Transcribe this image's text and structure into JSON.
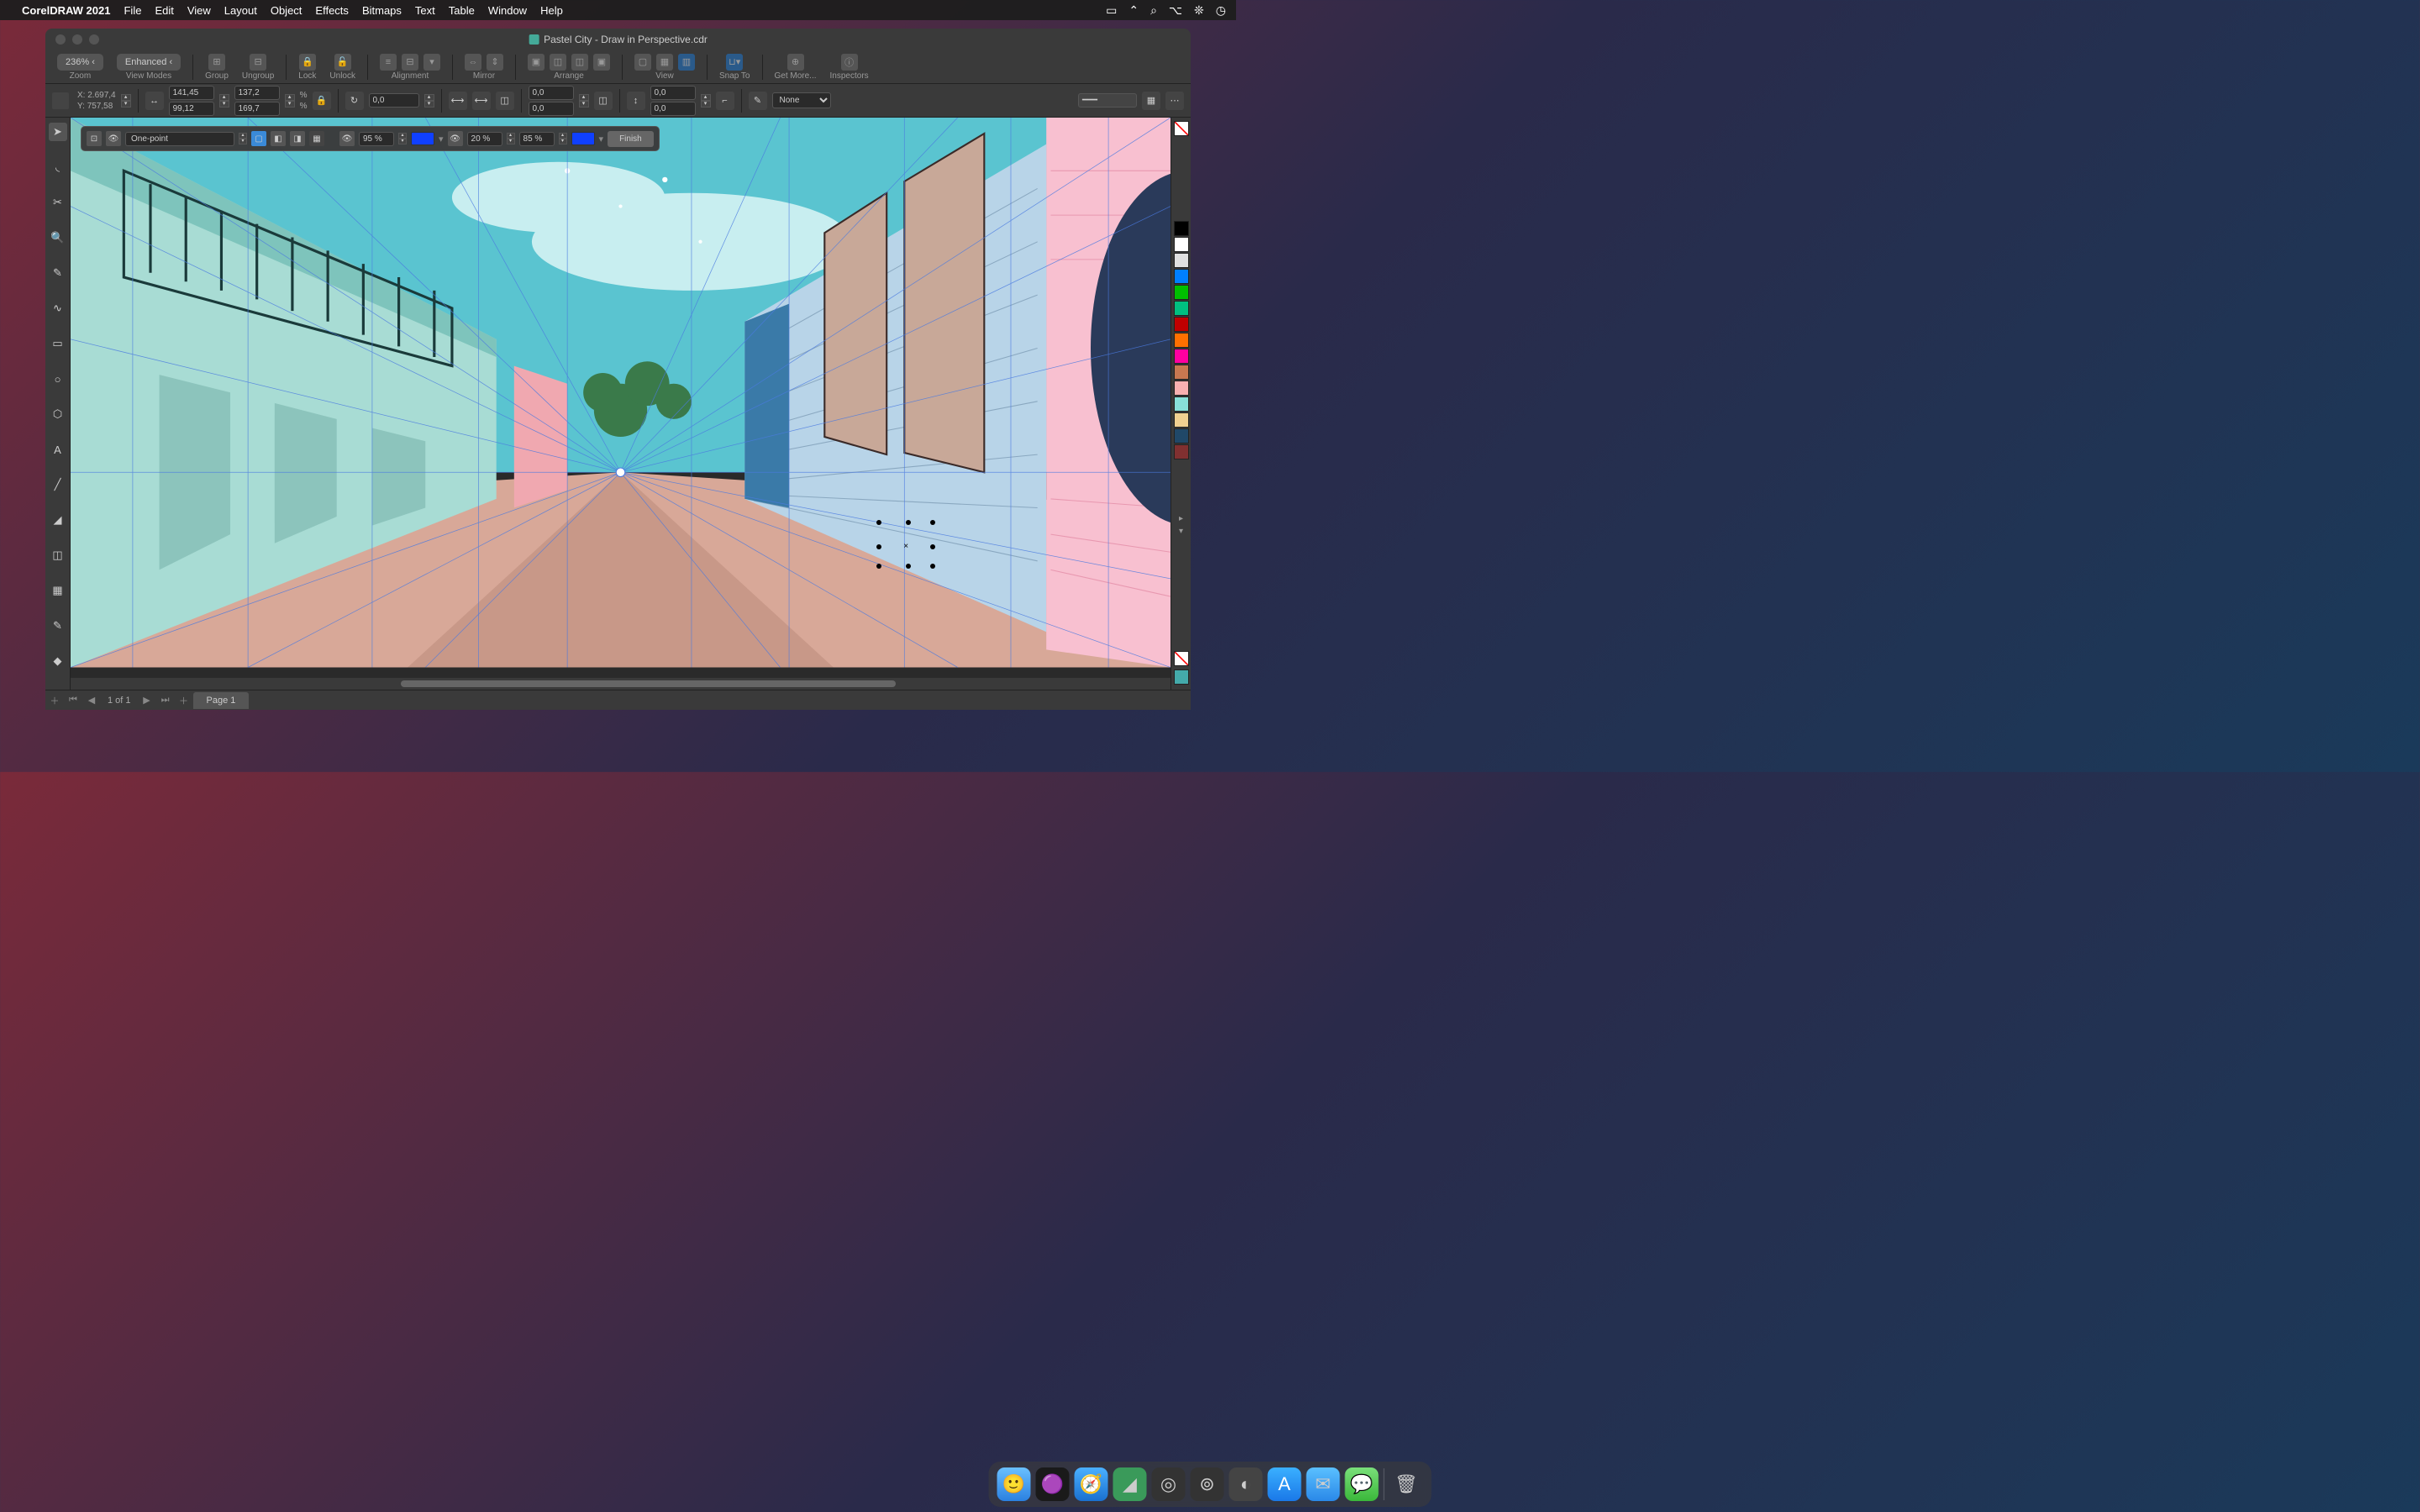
{
  "menubar": {
    "appname": "CorelDRAW 2021",
    "items": [
      "File",
      "Edit",
      "View",
      "Layout",
      "Object",
      "Effects",
      "Bitmaps",
      "Text",
      "Table",
      "Window",
      "Help"
    ]
  },
  "titlebar": {
    "title": "Pastel City - Draw in Perspective.cdr"
  },
  "toolbar1": {
    "zoom_value": "236% ‹",
    "zoom_label": "Zoom",
    "viewmode_value": "Enhanced ‹",
    "viewmode_label": "View Modes",
    "group_label": "Group",
    "ungroup_label": "Ungroup",
    "lock_label": "Lock",
    "unlock_label": "Unlock",
    "alignment_label": "Alignment",
    "mirror_label": "Mirror",
    "arrange_label": "Arrange",
    "view_label": "View",
    "snapto_label": "Snap To",
    "getmore_label": "Get More...",
    "inspectors_label": "Inspectors"
  },
  "propbar": {
    "x_label": "X:",
    "x_value": "2.697,4",
    "y_label": "Y:",
    "y_value": "757,58",
    "w_value": "141,45",
    "h_value": "99,12",
    "sx_value": "137,2",
    "sy_value": "169,7",
    "pct_label": "%",
    "rot_value": "0,0",
    "skew1": "0,0",
    "skew2": "0,0",
    "sp1": "0,0",
    "sp2": "0,0",
    "outline_value": "None"
  },
  "floatbar": {
    "perspective_type": "One-point",
    "opacity1": "95 %",
    "opacity2": "20 %",
    "opacity3": "85 %",
    "color1": "#1040ff",
    "color2": "#1040ff",
    "color3": "#1040ff",
    "finish_label": "Finish"
  },
  "palette_colors": [
    "#ffffff",
    "#000000",
    "#ffffff",
    "#e0e0e0",
    "#a0a0a0",
    "#606060",
    "#0080ff",
    "#00c000",
    "#ff0000",
    "#ffa000",
    "#ff00ff",
    "#c08060",
    "#f0a0a0",
    "#80e0e0",
    "#204060",
    "#802020"
  ],
  "tabbar": {
    "page_indicator": "1 of 1",
    "page_tab": "Page 1"
  },
  "dock_apps": [
    {
      "name": "finder",
      "color": "#3ba7ff",
      "icon": "😀"
    },
    {
      "name": "siri",
      "color": "#222",
      "icon": "🔮"
    },
    {
      "name": "safari",
      "color": "#2a8fd8",
      "icon": "🧭"
    },
    {
      "name": "coreldraw",
      "color": "#4a9",
      "icon": "✏"
    },
    {
      "name": "app5",
      "color": "#444",
      "icon": "◎"
    },
    {
      "name": "app6",
      "color": "#3a7",
      "icon": "⊕"
    },
    {
      "name": "app7",
      "color": "#555",
      "icon": "◐"
    },
    {
      "name": "appstore",
      "color": "#1a8fff",
      "icon": "A"
    },
    {
      "name": "mail",
      "color": "#3aa0f0",
      "icon": "✉"
    },
    {
      "name": "messages",
      "color": "#5c5",
      "icon": "💬"
    }
  ]
}
